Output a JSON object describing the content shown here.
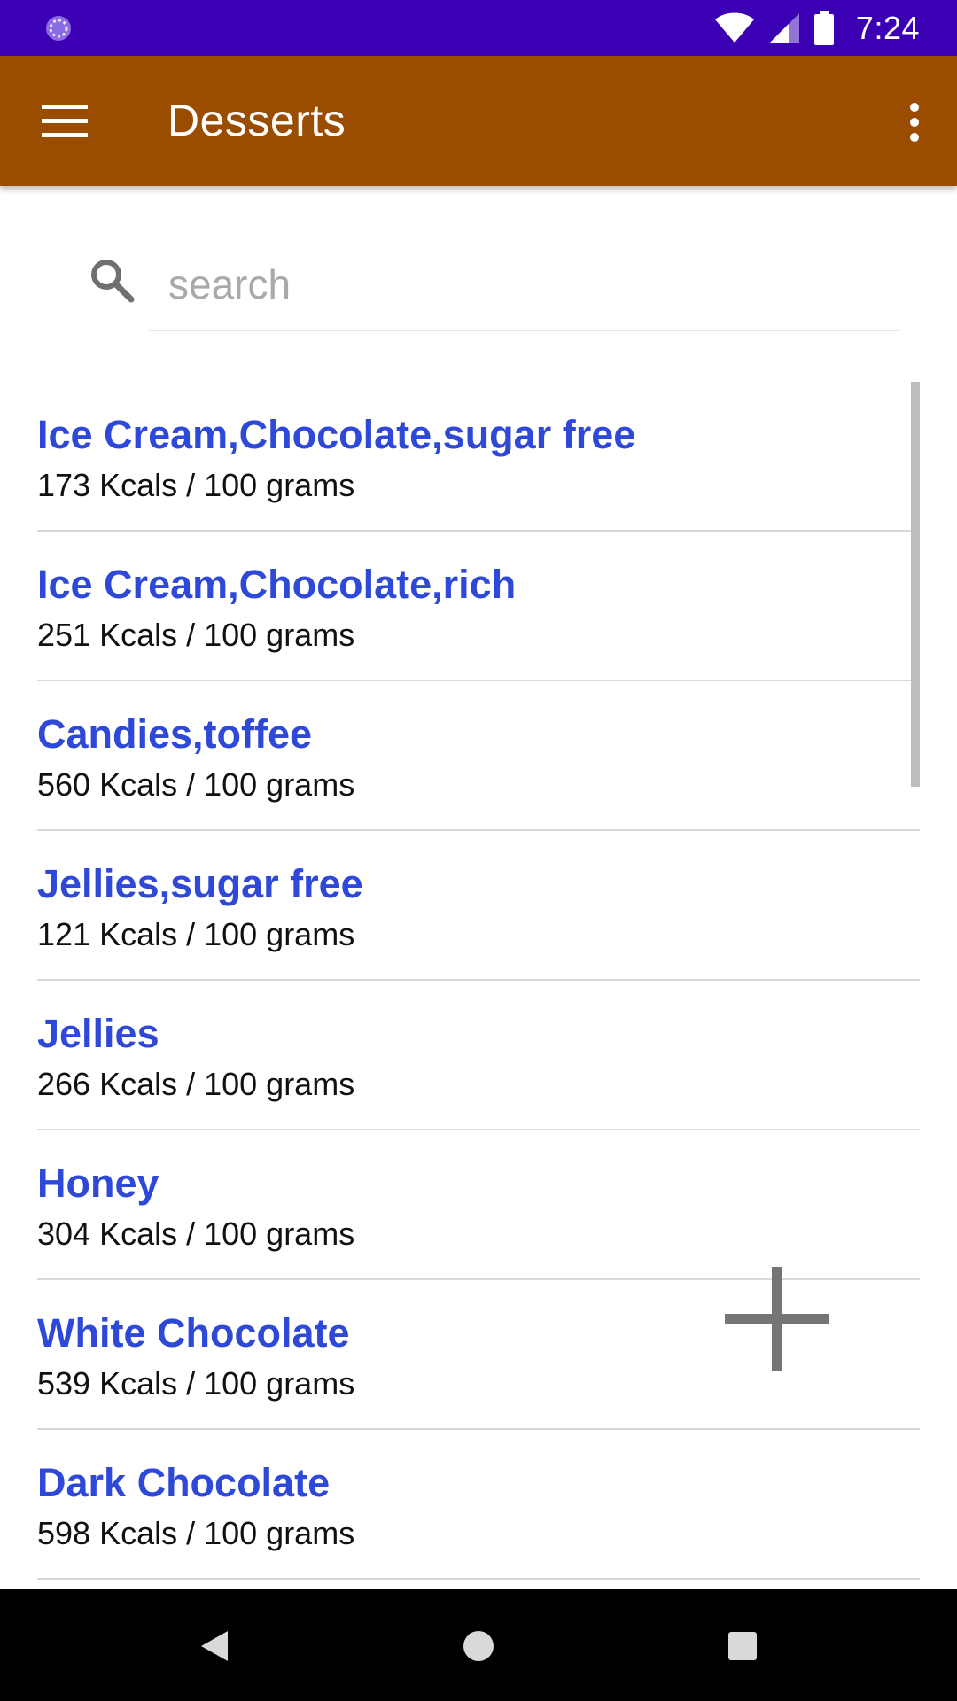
{
  "status_bar": {
    "time": "7:24",
    "color": "#3B00B4",
    "icons": [
      "loading-icon",
      "wifi-icon",
      "signal-icon",
      "battery-icon"
    ]
  },
  "app_bar": {
    "title": "Desserts",
    "color": "#9A4C00",
    "icons": [
      "menu-icon",
      "more-vert-icon"
    ]
  },
  "search": {
    "placeholder": "search",
    "value": "",
    "icon": "search-icon"
  },
  "items": [
    {
      "name": "Ice Cream,Chocolate,sugar free",
      "kcal": "173 Kcals / 100 grams"
    },
    {
      "name": "Ice Cream,Chocolate,rich",
      "kcal": "251 Kcals / 100 grams"
    },
    {
      "name": "Candies,toffee",
      "kcal": "560 Kcals / 100 grams"
    },
    {
      "name": "Jellies,sugar free",
      "kcal": "121 Kcals / 100 grams"
    },
    {
      "name": "Jellies",
      "kcal": "266 Kcals / 100 grams"
    },
    {
      "name": "Honey",
      "kcal": "304 Kcals / 100 grams"
    },
    {
      "name": "White Chocolate",
      "kcal": "539 Kcals / 100 grams"
    },
    {
      "name": "Dark Chocolate",
      "kcal": "598 Kcals / 100 grams"
    }
  ],
  "colors": {
    "item_title": "#2E48D8",
    "add_icon": "#757575"
  },
  "fab": {
    "icon": "plus-icon"
  },
  "nav_bar": {
    "icons": [
      "back-icon",
      "home-icon",
      "recents-icon"
    ]
  }
}
